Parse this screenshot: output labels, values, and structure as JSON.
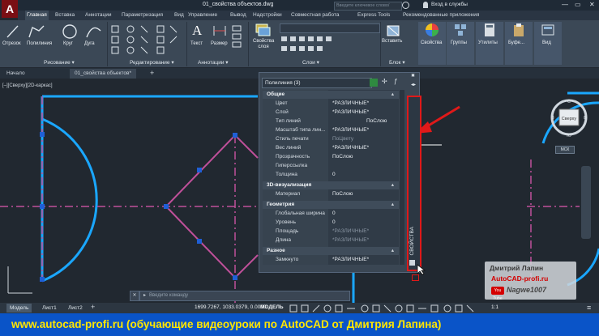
{
  "window": {
    "app_logo": "A",
    "title": "01_свойства объектов.dwg",
    "search_placeholder": "Введите ключевое слово/фразу",
    "signin": "Вход в службы"
  },
  "ribbon_tabs": [
    "Главная",
    "Вставка",
    "Аннотации",
    "Параметризация",
    "Вид",
    "Управление",
    "Вывод",
    "Надстройки",
    "Совместная работа",
    "Express Tools",
    "Рекомендованные приложения"
  ],
  "ribbon": {
    "draw": {
      "line": "Отрезок",
      "polyline": "Полилиния",
      "circle": "Круг",
      "arc": "Дуга",
      "label": "Рисование ▾"
    },
    "modify": {
      "label": "Редактирование ▾"
    },
    "annotation": {
      "text": "Текст",
      "dimension": "Размер",
      "label": "Аннотации ▾"
    },
    "layers": {
      "layer_props": "Свойства слоя",
      "label": "Слои ▾"
    },
    "block": {
      "insert": "Вставить",
      "label": "Блок ▾"
    },
    "properties": {
      "label": "Свойства"
    },
    "groups": {
      "label": "Группы"
    },
    "utilities": {
      "label": "Утилиты"
    },
    "clipboard": {
      "label": "Буфе..."
    },
    "view": {
      "label": "Вид"
    }
  },
  "file_tabs": [
    "Начало",
    "01_свойства объектов*"
  ],
  "viewport_label": "[–][Сверху][2D-каркас]",
  "properties_palette": {
    "selection": "Полилиния (3)",
    "side_label": "СВОЙСТВА",
    "sections": [
      {
        "title": "Общие",
        "rows": [
          {
            "key": "Цвет",
            "value": "*РАЗЛИЧНЫЕ*"
          },
          {
            "key": "Слой",
            "value": "*РАЗЛИЧНЫЕ*"
          },
          {
            "key": "Тип линий",
            "value": "ПоСлою"
          },
          {
            "key": "Масштаб типа лин...",
            "value": "*РАЗЛИЧНЫЕ*"
          },
          {
            "key": "Стиль печати",
            "value": "ПоЦвету"
          },
          {
            "key": "Вес линий",
            "value": "*РАЗЛИЧНЫЕ*"
          },
          {
            "key": "Прозрачность",
            "value": "ПоСлою"
          },
          {
            "key": "Гиперссылка",
            "value": ""
          },
          {
            "key": "Толщина",
            "value": "0"
          }
        ]
      },
      {
        "title": "3D-визуализация",
        "rows": [
          {
            "key": "Материал",
            "value": "ПоСлою"
          }
        ]
      },
      {
        "title": "Геометрия",
        "rows": [
          {
            "key": "Глобальная ширина",
            "value": "0"
          },
          {
            "key": "Уровень",
            "value": "0"
          },
          {
            "key": "Площадь",
            "value": "*РАЗЛИЧНЫЕ*"
          },
          {
            "key": "Длина",
            "value": "*РАЗЛИЧНЫЕ*"
          }
        ]
      },
      {
        "title": "Разное",
        "rows": [
          {
            "key": "Замкнуто",
            "value": "*РАЗЛИЧНЫЕ*"
          }
        ]
      }
    ]
  },
  "viewcube": {
    "face": "Сверху",
    "north": "С",
    "west": "З",
    "east": "В",
    "south": "Ю",
    "wcs": "МСК"
  },
  "command_placeholder": "Введите команду",
  "layout_tabs": [
    "Модель",
    "Лист1",
    "Лист2"
  ],
  "status": {
    "coords": "1699.7267, 1033.0379, 0.0000",
    "model": "МОДЕЛЬ",
    "scale": "1:1"
  },
  "watermark": {
    "name": "Дмитрий Лапин",
    "site": "AutoCAD-profi.ru",
    "yt": "You Tube",
    "handle": "Nagwe1007"
  },
  "footer": "www.autocad-profi.ru  (обучающие видеоуроки по AutoCAD от Дмитрия Лапина)",
  "colors": {
    "magenta": "#c0509a",
    "cyan": "#1aa7ff",
    "annotation_red": "#e01919",
    "footer_bg": "#0a54c8",
    "footer_text": "#ffe600"
  }
}
